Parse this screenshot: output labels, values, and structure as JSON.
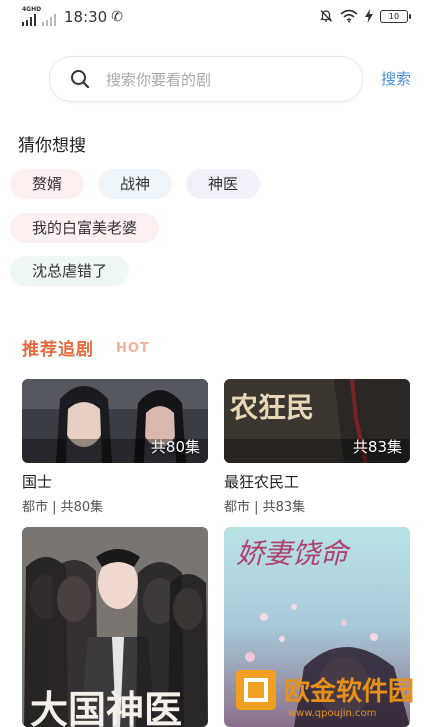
{
  "status_bar": {
    "network": "4GHD",
    "time": "18:30",
    "call_icon": "phone-icon",
    "battery": "10"
  },
  "search": {
    "placeholder": "搜索你要看的剧",
    "button_label": "搜索"
  },
  "guess": {
    "title": "猜你想搜",
    "tags": [
      "赘婿",
      "战神",
      "神医",
      "我的白富美老婆",
      "沈总虐错了"
    ]
  },
  "recommend": {
    "title": "推荐追剧",
    "badge": "HOT",
    "cards": [
      {
        "title": "国士",
        "meta": "都市 | 共80集",
        "episodes": "共80集"
      },
      {
        "title": "最狂农民工",
        "meta": "都市 | 共83集",
        "episodes": "共83集",
        "poster_text": "农狂民"
      },
      {
        "poster_text": "大国神医"
      },
      {
        "poster_text": "娇妻饶命"
      }
    ]
  },
  "watermark": {
    "text": "欧金软件园",
    "url": "www.qpoujin.com"
  },
  "colors": {
    "accent_blue": "#4a90e2",
    "hot_orange": "#e56b3f"
  }
}
